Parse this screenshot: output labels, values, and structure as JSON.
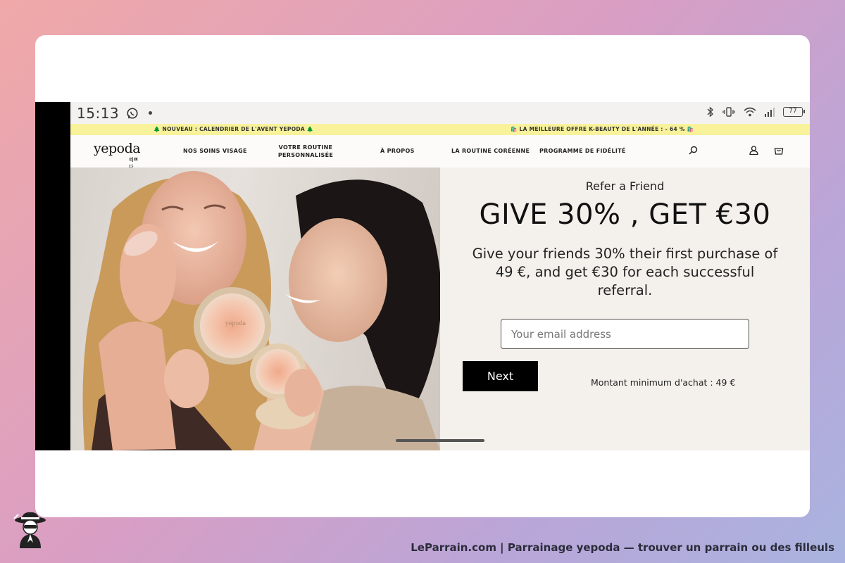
{
  "status_bar": {
    "time": "15:13",
    "battery": "77"
  },
  "announcement": {
    "left": "🌲 NOUVEAU : CALENDRIER DE L'AVENT YEPODA 🌲",
    "right": "🛍️ LA MEILLEURE OFFRE K-BEAUTY DE L'ANNÉE : - 64 % 🛍️"
  },
  "nav": {
    "logo": "yepoda",
    "logo_sub": "예쁘다",
    "items": [
      "NOS SOINS VISAGE",
      "VOTRE ROUTINE PERSONNALISÉE",
      "À PROPOS",
      "LA ROUTINE CORÉENNE",
      "PROGRAMME DE FIDÉLITÉ"
    ],
    "icons": [
      "search-icon",
      "account-icon",
      "cart-icon"
    ]
  },
  "hero": {
    "product_label": "yepoda"
  },
  "referral": {
    "title": "Refer a Friend",
    "headline": "GIVE 30% , GET €30",
    "description": "Give your friends 30% their first purchase of 49 €, and get €30 for each successful referral.",
    "email_placeholder": "Your email address",
    "next_label": "Next",
    "minimum": "Montant minimum d'achat : 49 €"
  },
  "footer": {
    "caption": "LeParrain.com | Parrainage yepoda — trouver un parrain ou des filleuls"
  },
  "colors": {
    "announcement_bg": "#f8f29a",
    "panel_bg": "#f4f1ec",
    "button_bg": "#000000"
  }
}
